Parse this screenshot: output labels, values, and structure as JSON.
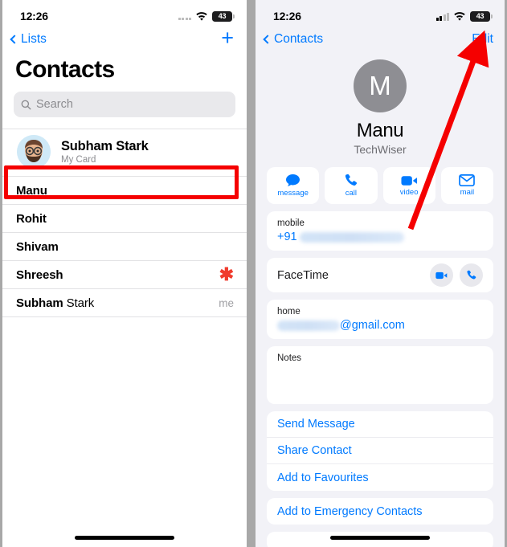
{
  "left": {
    "status": {
      "time": "12:26",
      "battery_level": "43",
      "wifi_icon": "wifi-icon",
      "signal_icon": "signal-dots-icon"
    },
    "nav": {
      "back_label": "Lists",
      "back_icon": "chevron-left-icon",
      "add_icon": "plus-icon"
    },
    "page_title": "Contacts",
    "search": {
      "placeholder": "Search",
      "icon": "search-icon"
    },
    "my_card": {
      "name": "Subham Stark",
      "subtitle": "My Card",
      "avatar_icon": "memoji-avatar"
    },
    "contacts": [
      {
        "first": "Manu",
        "last": "",
        "trailing": "",
        "highlighted": true
      },
      {
        "first": "Rohit",
        "last": "",
        "trailing": "",
        "highlighted": false
      },
      {
        "first": "Shivam",
        "last": "",
        "trailing": "",
        "highlighted": false
      },
      {
        "first": "Shreesh",
        "last": "",
        "trailing": "asterisk",
        "highlighted": false
      },
      {
        "first": "Subham",
        "last": " Stark",
        "trailing": "me",
        "highlighted": false
      }
    ],
    "annotation": {
      "type": "red-rectangle",
      "target": "Manu",
      "color": "#f50000"
    }
  },
  "right": {
    "status": {
      "time": "12:26",
      "battery_level": "43",
      "wifi_icon": "wifi-icon",
      "signal_icon": "signal-bars-icon"
    },
    "nav": {
      "back_label": "Contacts",
      "back_icon": "chevron-left-icon",
      "edit_label": "Edit"
    },
    "hero": {
      "initial": "M",
      "name": "Manu",
      "organization": "TechWiser"
    },
    "actions": [
      {
        "label": "message",
        "icon": "message-bubble-icon"
      },
      {
        "label": "call",
        "icon": "phone-icon"
      },
      {
        "label": "video",
        "icon": "video-camera-icon"
      },
      {
        "label": "mail",
        "icon": "envelope-icon"
      }
    ],
    "phone_field": {
      "label": "mobile",
      "value_prefix": "+91",
      "value_redacted": true
    },
    "facetime": {
      "label": "FaceTime",
      "video_icon": "video-camera-icon",
      "audio_icon": "phone-icon"
    },
    "email_field": {
      "label": "home",
      "value_suffix": "@gmail.com",
      "value_redacted": true
    },
    "notes": {
      "label": "Notes",
      "value": ""
    },
    "links": [
      "Send Message",
      "Share Contact",
      "Add to Favourites"
    ],
    "emergency_links": [
      "Add to Emergency Contacts"
    ],
    "annotation": {
      "type": "red-arrow",
      "target": "Edit",
      "color": "#f50000"
    }
  },
  "theme": {
    "accent": "#007aff",
    "annotation_red": "#f50000",
    "page_bg": "#f2f2f7"
  }
}
